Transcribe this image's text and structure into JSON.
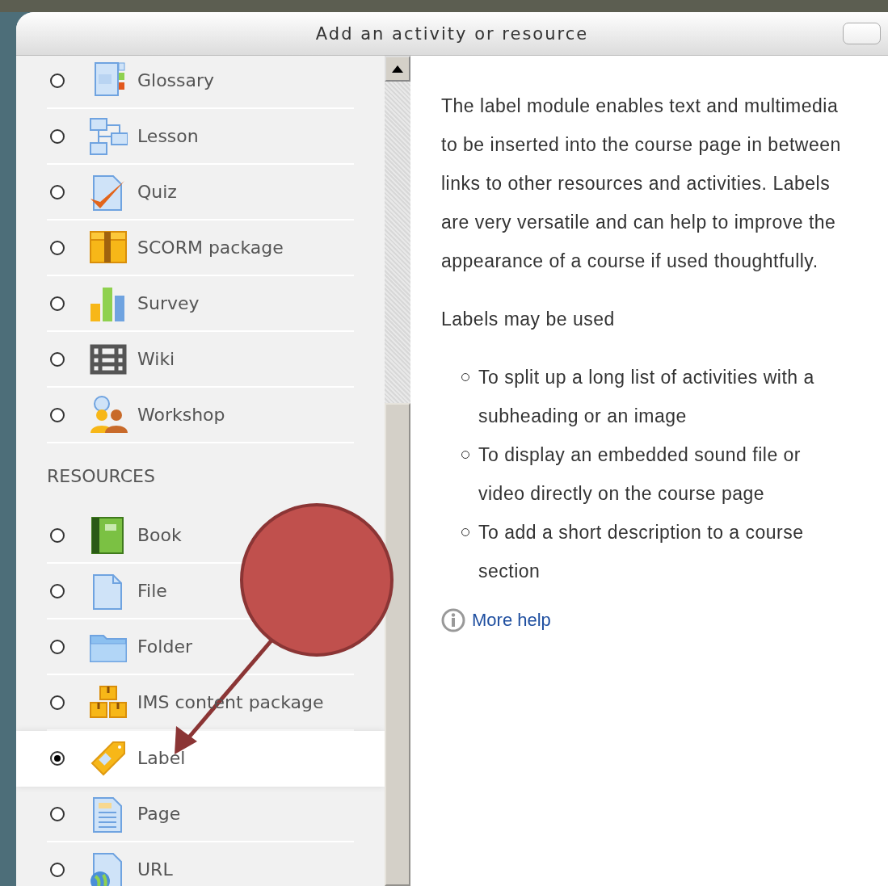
{
  "dialog": {
    "title": "Add an activity or resource"
  },
  "activities": [
    {
      "name": "Glossary",
      "kind": "glossary",
      "selected": false
    },
    {
      "name": "Lesson",
      "kind": "lesson",
      "selected": false
    },
    {
      "name": "Quiz",
      "kind": "quiz",
      "selected": false
    },
    {
      "name": "SCORM package",
      "kind": "package",
      "selected": false
    },
    {
      "name": "Survey",
      "kind": "survey",
      "selected": false
    },
    {
      "name": "Wiki",
      "kind": "wiki",
      "selected": false
    },
    {
      "name": "Workshop",
      "kind": "workshop",
      "selected": false
    }
  ],
  "resources_heading": "RESOURCES",
  "resources": [
    {
      "name": "Book",
      "kind": "book",
      "selected": false
    },
    {
      "name": "File",
      "kind": "file",
      "selected": false
    },
    {
      "name": "Folder",
      "kind": "folder",
      "selected": false
    },
    {
      "name": "IMS content package",
      "kind": "ims",
      "selected": false
    },
    {
      "name": "Label",
      "kind": "label",
      "selected": true
    },
    {
      "name": "Page",
      "kind": "page",
      "selected": false
    },
    {
      "name": "URL",
      "kind": "url",
      "selected": false
    }
  ],
  "help": {
    "paragraphs": [
      "The label module enables text and multimedia to be inserted into the course page in between links to other resources and activities. Labels are very versatile and can help to improve the appearance of a course if used thoughtfully.",
      "Labels may be used"
    ],
    "bullets": [
      "To split up a long list of activities with a subheading or an image",
      "To display an embedded sound file or video directly on the course page",
      "To add a short description to a course section"
    ],
    "more_help": "More help"
  }
}
